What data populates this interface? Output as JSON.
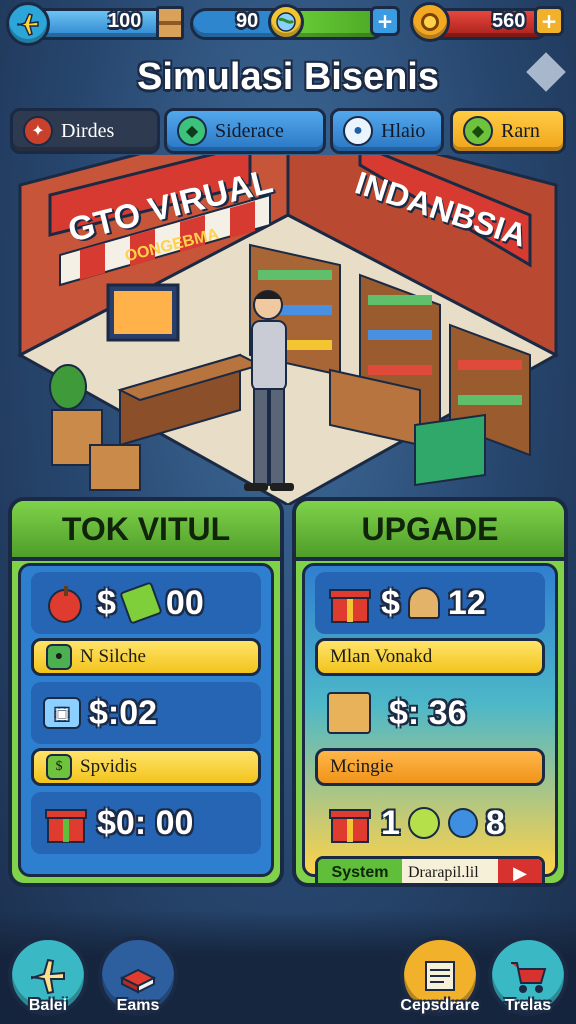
{
  "topbar": {
    "resource1_value": "100",
    "resource2_value": "90",
    "resource3_value": "560"
  },
  "title": "Simulasi Bisenis",
  "tabs": [
    {
      "label": "Dirdes"
    },
    {
      "label": "Siderace"
    },
    {
      "label": "Hlaio"
    },
    {
      "label": "Rarn"
    }
  ],
  "scene": {
    "sign_left": "GTO VIRUAL",
    "sign_right": "INDANBSIA",
    "small_sign": "OONGEBMA"
  },
  "left_panel": {
    "title": "TOK VITUL",
    "row1": {
      "currency": "$",
      "value": "00"
    },
    "row2_label": "N Silche",
    "row3_value": "$:02",
    "row4_label": "Spvidis",
    "row5_value": "$0: 00"
  },
  "right_panel": {
    "title": "UPGADE",
    "row1": {
      "currency": "$",
      "value": "12"
    },
    "row2_label": "Mlan Vonakd",
    "row3_value": "$: 36",
    "row4_label": "Mcingie",
    "row5": {
      "num1": "1",
      "num2": "8"
    },
    "system_label": "System",
    "action_label": "Drarapil.lil"
  },
  "bottom_nav": [
    {
      "label": "Balei"
    },
    {
      "label": "Eams"
    },
    {
      "label": "Cepsdrare"
    },
    {
      "label": "Trelas"
    }
  ],
  "colors": {
    "accent_green": "#5fb832",
    "panel_blue": "#2f7fd0",
    "gold": "#f4b322",
    "red": "#d8322e"
  },
  "icons": [
    "airplane-icon",
    "crate-icon",
    "globe-icon",
    "coin-icon",
    "gift-icon",
    "shopping-cart-icon",
    "map-icon",
    "book-icon"
  ]
}
